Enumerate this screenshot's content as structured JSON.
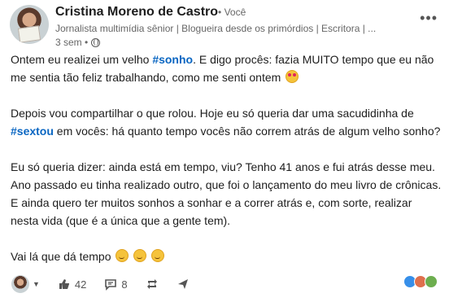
{
  "header": {
    "author_name": "Cristina Moreno de Castro",
    "relationship": "• Você",
    "headline": "Jornalista multimídia sênior | Blogueira desde os primórdios | Escritora | ...",
    "time": "3 sem •",
    "visibility_icon": "globe-icon",
    "more_icon": "more-options-icon"
  },
  "post": {
    "p1_a": "Ontem eu realizei um velho ",
    "p1_tag": "#sonho",
    "p1_b": ". E digo procês: fazia MUITO tempo que eu não me sentia tão feliz trabalhando, como me senti ontem",
    "p2_a": "Depois vou compartilhar o que rolou. Hoje eu só queria dar uma sacudidinha de ",
    "p2_tag": "#sextou",
    "p2_b": " em vocês: há quanto tempo vocês não correm atrás de algum velho sonho?",
    "p3": "Eu só queria dizer: ainda está em tempo, viu? Tenho 41 anos e fui atrás desse meu. Ano passado eu tinha realizado outro, que foi o lançamento do meu livro de crônicas. E ainda quero ter muitos sonhos a sonhar e a correr atrás e, com sorte, realizar nesta vida (que é a única que a gente tem).",
    "p4": "Vai lá que dá tempo"
  },
  "actions": {
    "like_count": "42",
    "comment_count": "8"
  },
  "icons": {
    "like": "thumbs-up-icon",
    "comment": "comment-icon",
    "repost": "repost-icon",
    "send": "send-icon"
  }
}
